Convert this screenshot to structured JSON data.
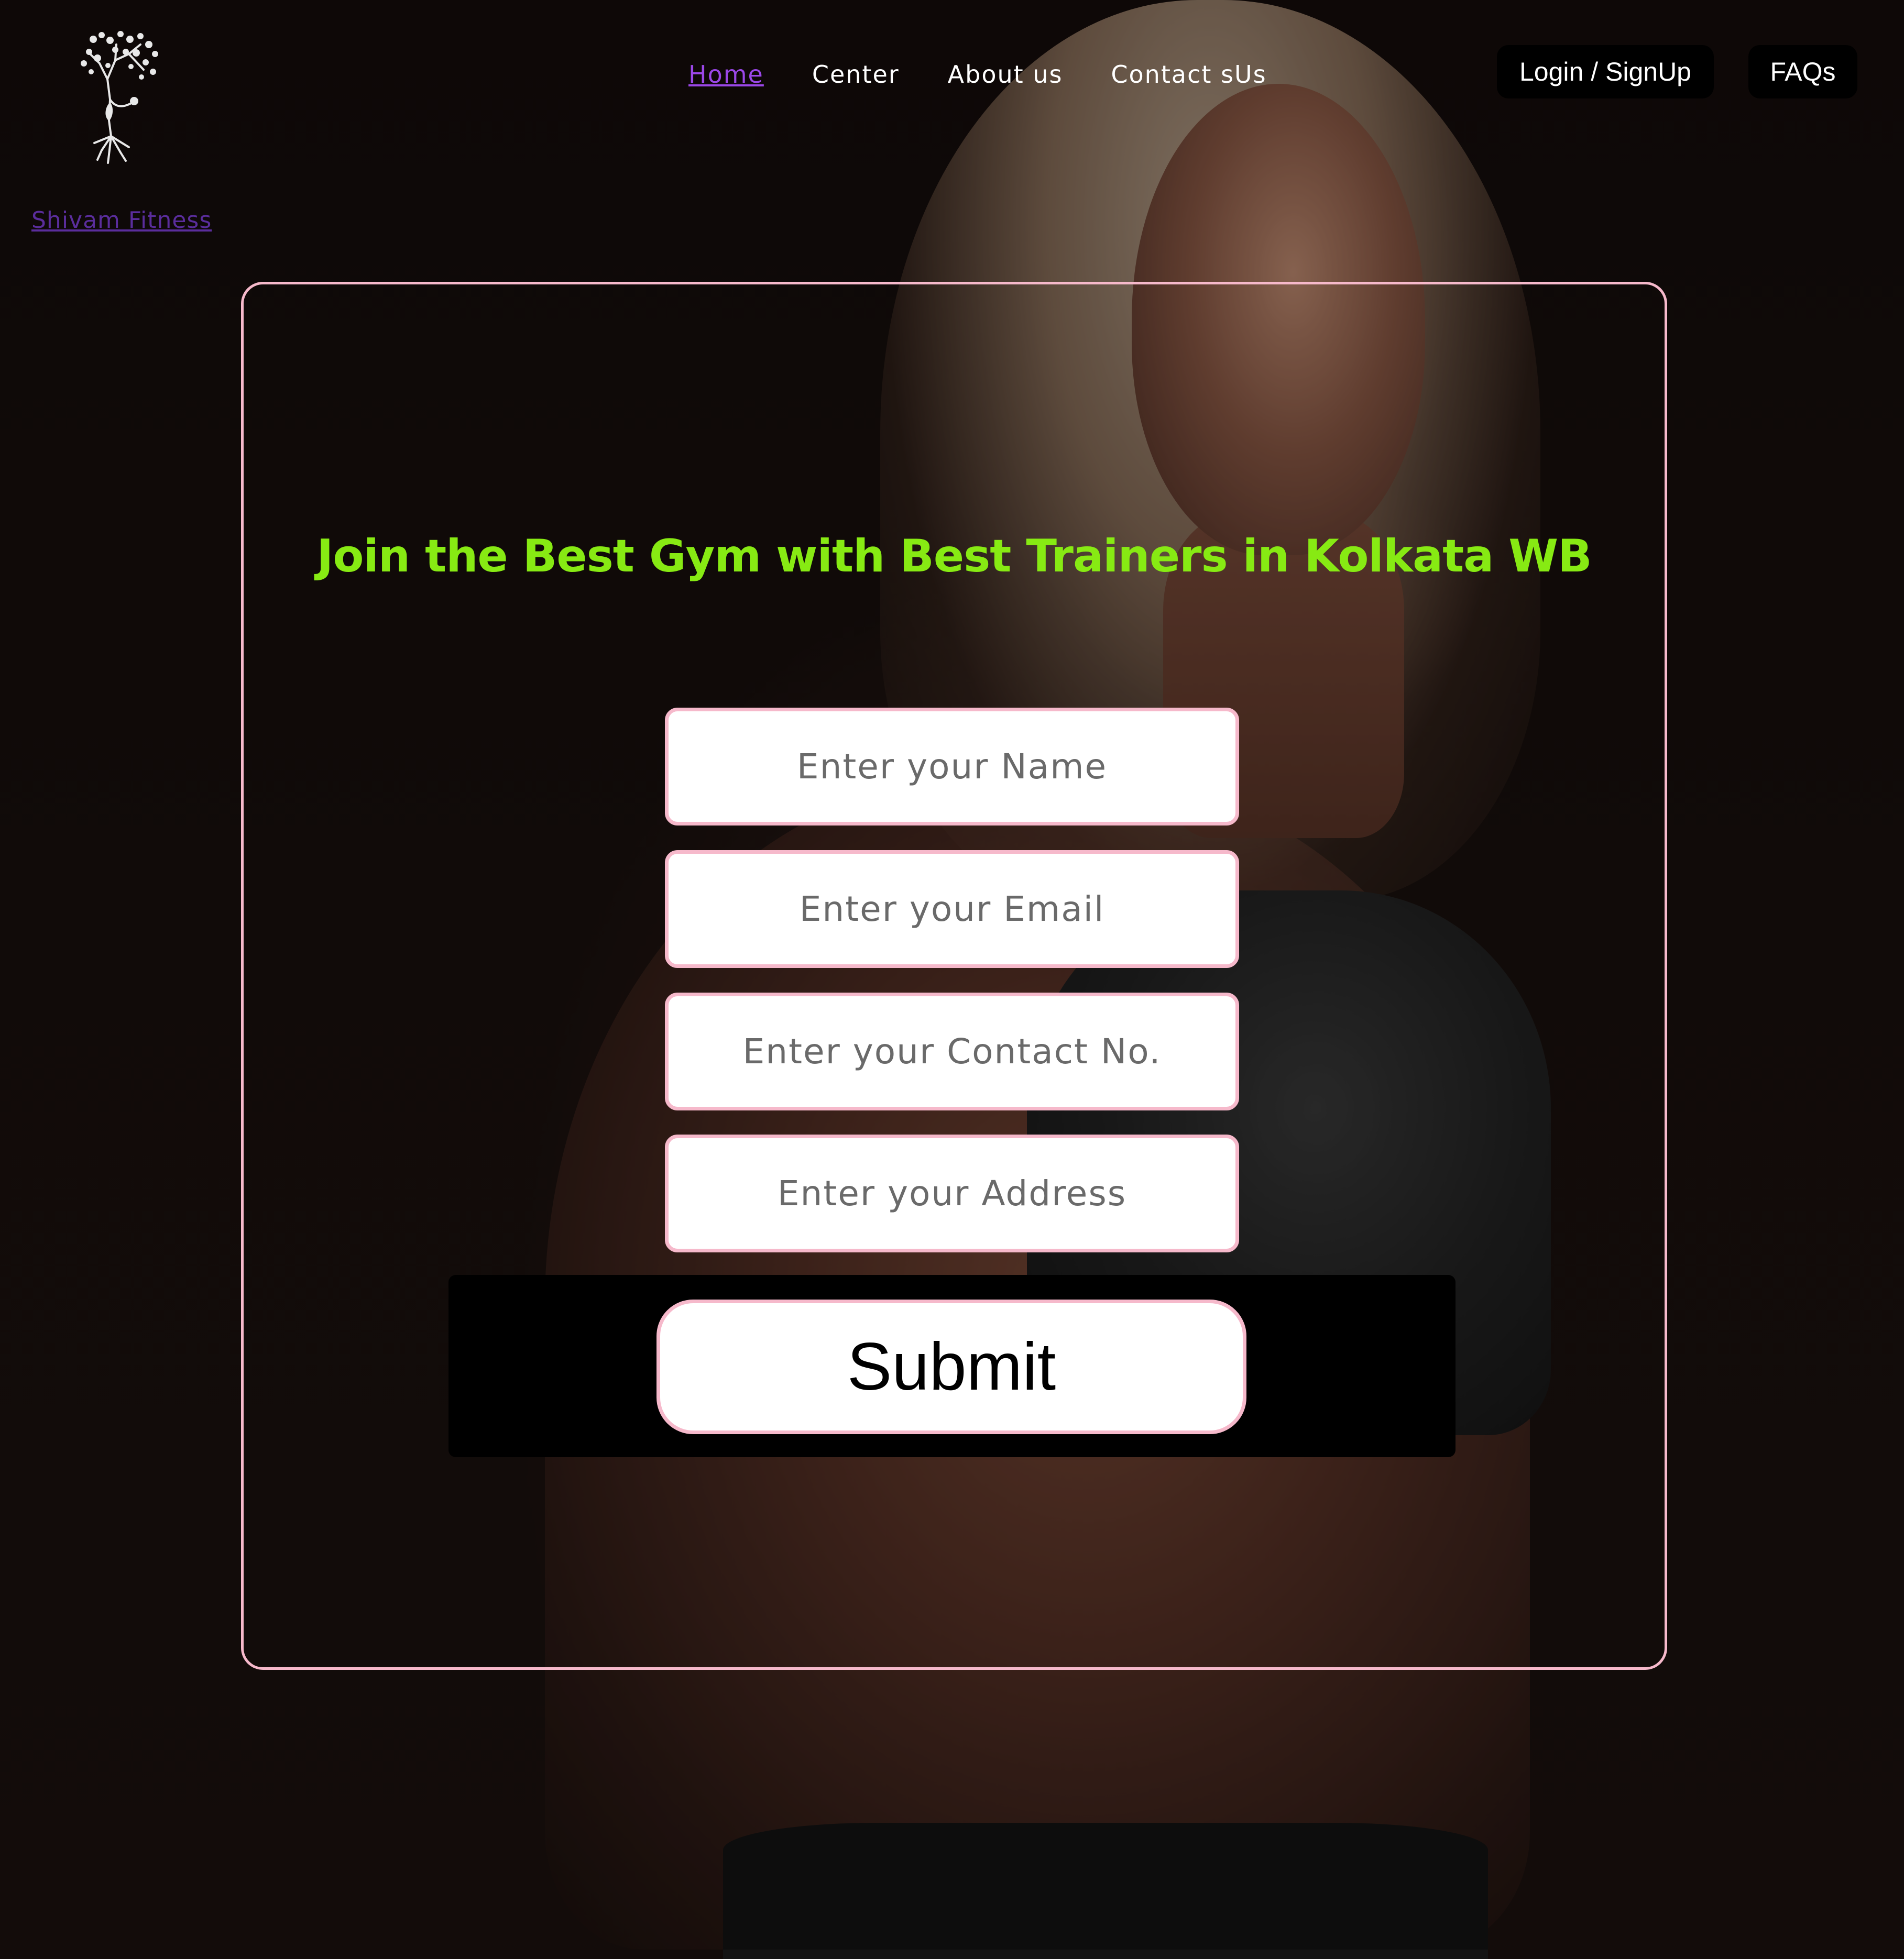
{
  "header": {
    "brand_name": "Shivam Fitness",
    "logo_icon": "yoga-tree-logo-icon",
    "nav": [
      {
        "label": "Home",
        "active": true
      },
      {
        "label": "Center",
        "active": false
      },
      {
        "label": "About us",
        "active": false
      },
      {
        "label": "Contact sUs",
        "active": false
      }
    ],
    "login_label": "Login / SignUp",
    "faq_label": "FAQs"
  },
  "hero": {
    "headline": "Join the Best Gym with Best Trainers in Kolkata WB",
    "background": "fitness-woman-photo"
  },
  "form": {
    "name_placeholder": "Enter your Name",
    "email_placeholder": "Enter your Email",
    "contact_placeholder": "Enter your Contact No.",
    "address_placeholder": "Enter your Address",
    "submit_label": "Submit"
  },
  "colors": {
    "accent_green": "#87ea13",
    "border_pink": "#f6b9cb",
    "active_nav": "#9b47e8",
    "brand_link": "#5a2d9c"
  }
}
